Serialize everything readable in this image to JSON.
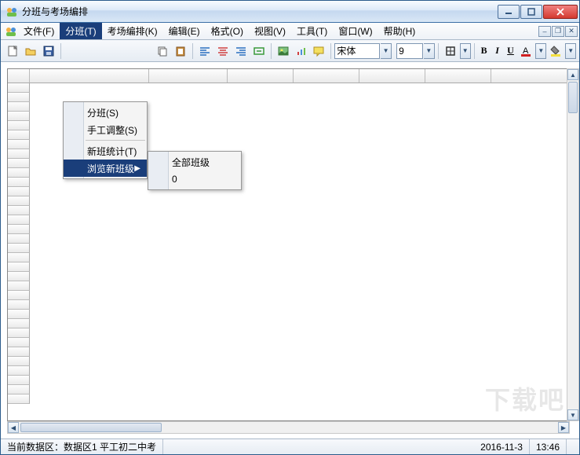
{
  "window": {
    "title": "分班与考场编排"
  },
  "menus": {
    "file": "文件(F)",
    "divide": "分班(T)",
    "exam": "考场编排(K)",
    "edit": "编辑(E)",
    "format": "格式(O)",
    "view": "视图(V)",
    "tools": "工具(T)",
    "window": "窗口(W)",
    "help": "帮助(H)"
  },
  "dropdown1": {
    "item1": "分班(S)",
    "item2": "手工调整(S)",
    "item3": "新班统计(T)",
    "item4": "浏览新班级"
  },
  "dropdown2": {
    "item1": "全部班级",
    "item2": "0"
  },
  "toolbar": {
    "font_name": "宋体",
    "font_size": "9",
    "bold": "B",
    "italic": "I",
    "underline": "U"
  },
  "statusbar": {
    "label": "当前数据区：",
    "value": "数据区1 平工初二中考",
    "date": "2016-11-3",
    "time": "13:46"
  },
  "watermark": "下载吧"
}
